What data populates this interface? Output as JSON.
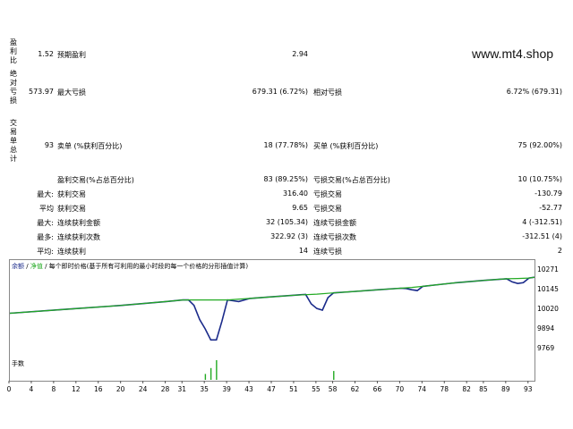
{
  "watermark": "www.mt4.shop",
  "stats": {
    "profit_factor": {
      "label": "盈利比",
      "value": "1.52",
      "key": "预期盈利",
      "key_value": "2.94"
    },
    "absolute_drawdown": {
      "label": "绝对亏损",
      "value": "573.97",
      "key": "最大亏损",
      "key_value": "679.31 (6.72%)",
      "key2": "相对亏损",
      "key2_value": "6.72% (679.31)"
    },
    "trades": {
      "label": "交易单总计",
      "value": "93",
      "key": "卖单 (%获利百分比)",
      "key_value": "18 (77.78%)",
      "key2": "买单 (%获利百分比)",
      "key2_value": "75 (92.00%)"
    },
    "rows": [
      {
        "left_label": "",
        "left_key": "盈利交易(%占总百分比)",
        "left_value": "83 (89.25%)",
        "right_key": "亏损交易(%占总百分比)",
        "right_value": "10 (10.75%)"
      },
      {
        "left_label": "最大:",
        "left_key": "获利交易",
        "left_value": "316.40",
        "right_key": "亏损交易",
        "right_value": "-130.79"
      },
      {
        "left_label": "平均",
        "left_key": "获利交易",
        "left_value": "9.65",
        "right_key": "亏损交易",
        "right_value": "-52.77"
      },
      {
        "left_label": "最大:",
        "left_key": "连续获利金额",
        "left_value": "32 (105.34)",
        "right_key": "连续亏损金额",
        "right_value": "4 (-312.51)"
      },
      {
        "left_label": "最多:",
        "left_key": "连续获利次数",
        "left_value": "322.92 (3)",
        "right_key": "连续亏损次数",
        "right_value": "-312.51 (4)"
      },
      {
        "left_label": "平均:",
        "left_key": "连续获利",
        "left_value": "14",
        "right_key": "连续亏损",
        "right_value": "2"
      }
    ]
  },
  "chart": {
    "legend_balance": "余额",
    "legend_equity": "净值",
    "legend_desc": "每个即时价格(基于所有可利用的最小时段的每一个价格的分形插值计算)",
    "volume_label": "手数",
    "colors": {
      "balance": "#1a2a8a",
      "equity": "#22aa22"
    }
  },
  "chart_data": {
    "type": "line",
    "y_ticks": [
      "10271",
      "10145",
      "10020",
      "9894",
      "9769"
    ],
    "ylim": [
      9769,
      10271
    ],
    "x_ticks": [
      "0",
      "4",
      "8",
      "12",
      "16",
      "20",
      "24",
      "28",
      "31",
      "35",
      "39",
      "43",
      "47",
      "51",
      "55",
      "58",
      "62",
      "66",
      "70",
      "74",
      "78",
      "82",
      "85",
      "89",
      "93"
    ],
    "xlim": [
      0,
      94
    ],
    "series": [
      {
        "name": "余额",
        "x": [
          0,
          10,
          20,
          28,
          31,
          35,
          37,
          39,
          43,
          47,
          51,
          55,
          58,
          62,
          66,
          70,
          72,
          74,
          76,
          80,
          85,
          89,
          91,
          93,
          94
        ],
        "values": [
          10000,
          10025,
          10050,
          10075,
          10085,
          10085,
          10085,
          10085,
          10095,
          10105,
          10115,
          10122,
          10130,
          10140,
          10150,
          10160,
          10165,
          10172,
          10180,
          10195,
          10210,
          10220,
          10222,
          10225,
          10230
        ]
      },
      {
        "name": "净值",
        "x": [
          0,
          10,
          20,
          28,
          31,
          32,
          33,
          34,
          35,
          36,
          37,
          38,
          39,
          40,
          41,
          43,
          47,
          51,
          52,
          53,
          54,
          55,
          56,
          57,
          58,
          62,
          66,
          70,
          71,
          72,
          73,
          74,
          76,
          80,
          85,
          89,
          90,
          91,
          92,
          93,
          94
        ],
        "values": [
          10000,
          10025,
          10050,
          10075,
          10085,
          10085,
          10050,
          9960,
          9900,
          9830,
          9830,
          9950,
          10085,
          10080,
          10075,
          10095,
          10105,
          10115,
          10118,
          10120,
          10060,
          10030,
          10020,
          10100,
          10130,
          10140,
          10150,
          10160,
          10158,
          10150,
          10145,
          10172,
          10180,
          10195,
          10210,
          10220,
          10200,
          10190,
          10195,
          10225,
          10230
        ]
      }
    ],
    "volume": {
      "x": [
        35,
        36,
        37,
        58
      ],
      "values": [
        0.3,
        0.6,
        1.0,
        0.45
      ]
    }
  }
}
